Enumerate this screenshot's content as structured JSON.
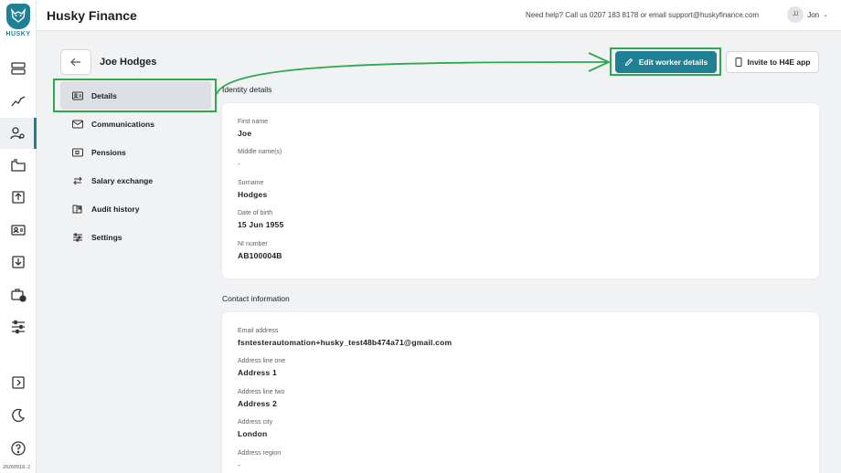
{
  "brand": {
    "logo_text": "HUSKY",
    "accent": "#1f7f93"
  },
  "header": {
    "title": "Husky Finance",
    "help_text": "Need help? Call us 0207 183 8178 or email support@huskyfinance.com",
    "user_initials": "JJ",
    "user_name": "Jon"
  },
  "rail": {
    "items": [
      "list-icon",
      "chart-icon",
      "users-icon",
      "folder-icon",
      "upload-icon",
      "id-card-icon",
      "download-icon",
      "briefcase-clock-icon",
      "sliders-icon"
    ],
    "bottom_items": [
      "collapse-icon",
      "moon-icon",
      "help-icon"
    ],
    "version": "20260918.2"
  },
  "worker": {
    "name": "Joe Hodges"
  },
  "subnav": {
    "items": [
      {
        "label": "Details",
        "icon": "id-card-icon",
        "active": true
      },
      {
        "label": "Communications",
        "icon": "mail-icon"
      },
      {
        "label": "Pensions",
        "icon": "wallet-icon"
      },
      {
        "label": "Salary exchange",
        "icon": "swap-icon"
      },
      {
        "label": "Audit history",
        "icon": "book-icon"
      },
      {
        "label": "Settings",
        "icon": "sliders-icon"
      }
    ]
  },
  "actions": {
    "edit_label": "Edit worker details",
    "invite_label": "Invite to H4E app"
  },
  "identity": {
    "title": "Identity details",
    "fields": [
      {
        "label": "First name",
        "value": "Joe"
      },
      {
        "label": "Middle name(s)",
        "value": "-"
      },
      {
        "label": "Surname",
        "value": "Hodges"
      },
      {
        "label": "Date of birth",
        "value": "15 Jun 1955"
      },
      {
        "label": "NI number",
        "value": "AB100004B"
      }
    ]
  },
  "contact": {
    "title": "Contact information",
    "fields": [
      {
        "label": "Email address",
        "value": "fsntesterautomation+husky_test48b474a71@gmail.com"
      },
      {
        "label": "Address line one",
        "value": "Address 1"
      },
      {
        "label": "Address line two",
        "value": "Address 2"
      },
      {
        "label": "Address city",
        "value": "London"
      },
      {
        "label": "Address region",
        "value": "-"
      }
    ]
  },
  "annotation_color": "#2fa84f"
}
